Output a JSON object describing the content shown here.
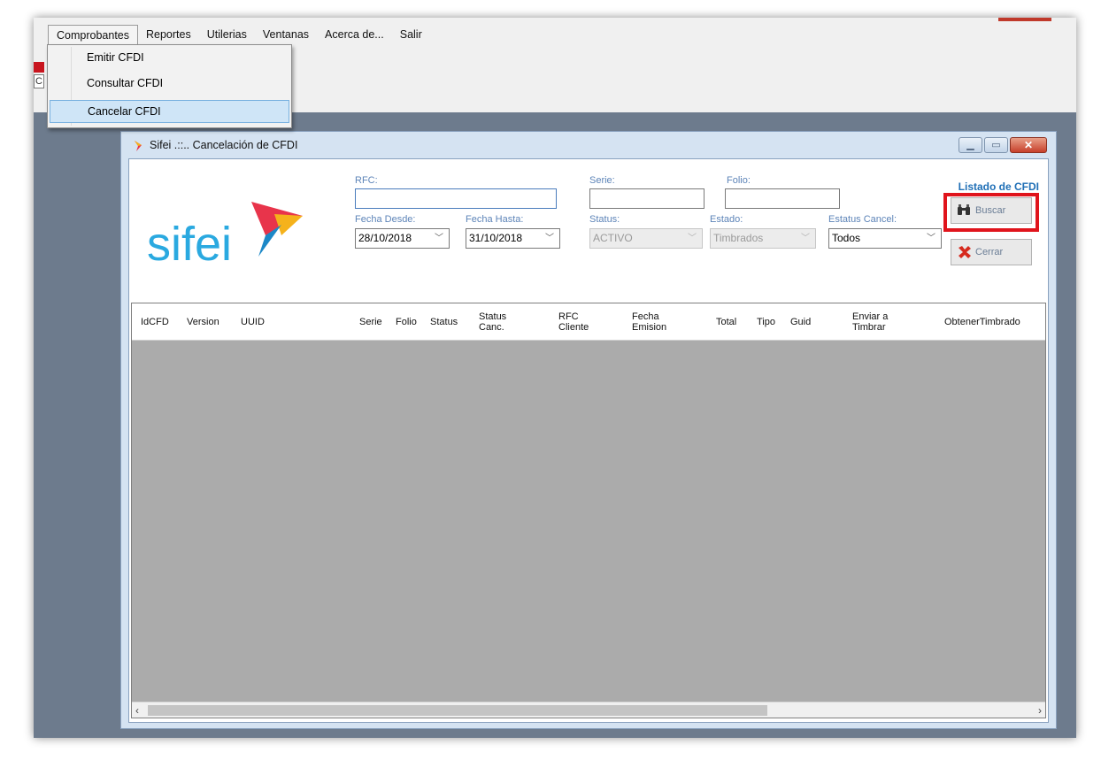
{
  "menu": {
    "items": [
      {
        "label": "Comprobantes"
      },
      {
        "label": "Reportes"
      },
      {
        "label": "Utilerias"
      },
      {
        "label": "Ventanas"
      },
      {
        "label": "Acerca de..."
      },
      {
        "label": "Salir"
      }
    ],
    "dropdown": [
      "Emitir CFDI",
      "Consultar CFDI",
      "Cancelar CFDI"
    ],
    "highlighted": "Cancelar CFDI"
  },
  "left_edge_char": "C",
  "window": {
    "title": "Sifei .::.. Cancelación de CFDI",
    "buttons": [
      "minimize",
      "maximize",
      "close"
    ]
  },
  "logo": {
    "text": "sifei"
  },
  "form": {
    "rfc_label": "RFC:",
    "rfc_value": "",
    "serie_label": "Serie:",
    "serie_value": "",
    "folio_label": "Folio:",
    "folio_value": "",
    "fecha_desde_label": "Fecha Desde:",
    "fecha_desde_value": "28/10/2018",
    "fecha_hasta_label": "Fecha Hasta:",
    "fecha_hasta_value": "31/10/2018",
    "status_label": "Status:",
    "status_value": "ACTIVO",
    "estado_label": "Estado:",
    "estado_value": "Timbrados",
    "estatus_cancel_label": "Estatus Cancel:",
    "estatus_cancel_value": "Todos"
  },
  "side": {
    "listado": "Listado de CFDI",
    "buscar": "Buscar",
    "cerrar": "Cerrar"
  },
  "grid": {
    "columns": [
      "IdCFD",
      "Version",
      "UUID",
      "Serie",
      "Folio",
      "Status",
      "Status Canc.",
      "RFC Cliente",
      "Fecha Emision",
      "Total",
      "Tipo",
      "Guid",
      "Enviar a Timbrar",
      "ObtenerTimbrado"
    ],
    "rows": []
  },
  "colors": {
    "highlight_box": "#e0141c",
    "menu_highlight": "#cfe5f7",
    "logo_blue": "#2aa9e0",
    "grid_background": "#ababab"
  }
}
